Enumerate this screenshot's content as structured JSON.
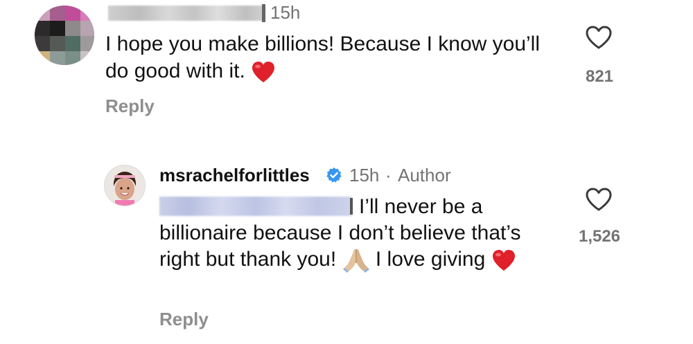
{
  "comment_1": {
    "username_redacted": true,
    "time": "15h",
    "text": "I hope you make billions! Because I know you’ll do good with it.",
    "emoji": "heart-emoji",
    "reply_label": "Reply",
    "likes": "821"
  },
  "comment_2": {
    "username": "msrachelforlittles",
    "verified": true,
    "time": "15h",
    "separator": "·",
    "role": "Author",
    "mention_redacted": true,
    "text_part1": "I’ll never be a billionaire because I don’t believe that’s right but thank you!",
    "text_part2": "I love giving",
    "emojis": [
      "folded-hands-emoji",
      "heart-emoji"
    ],
    "reply_label": "Reply",
    "likes": "1,526"
  },
  "colors": {
    "primary_text": "#111111",
    "secondary_text": "#737373",
    "reply_text": "#8e8e8e",
    "verified_blue": "#3897f0",
    "heart_red": "#e0202a"
  }
}
